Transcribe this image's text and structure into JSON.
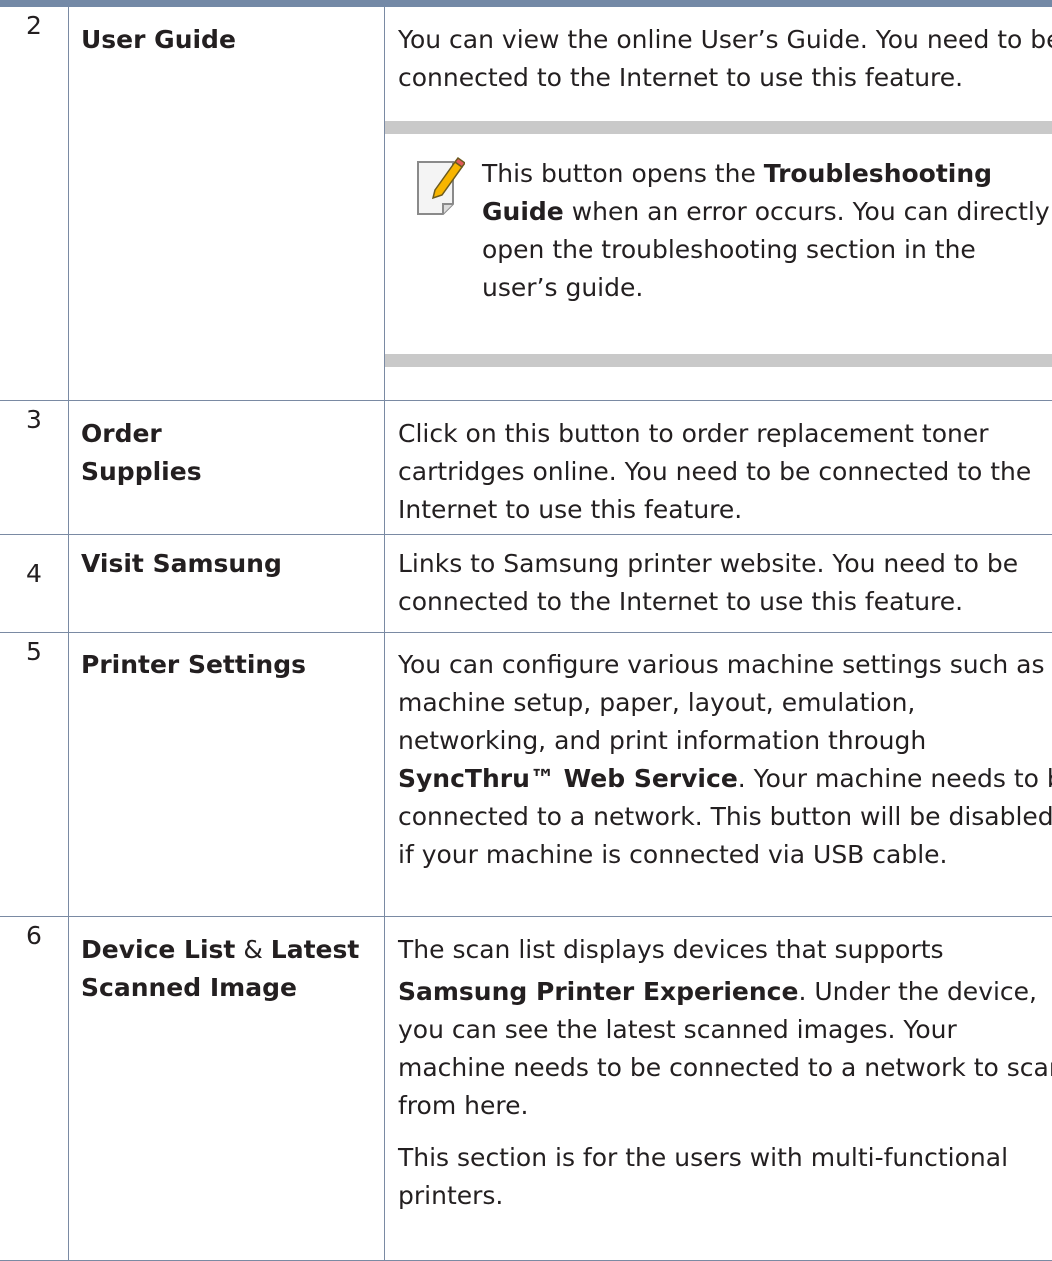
{
  "rows": [
    {
      "num": "2",
      "name": "User Guide",
      "desc_lines": [
        "You can view the online User’s Guide. You need to be",
        "connected to the Internet to use this feature."
      ],
      "note": {
        "icon": "note-pencil-icon",
        "line1_a": "This button opens the ",
        "line1_b": "Troubleshooting",
        "line2_a": "Guide",
        "line2_b": " when an error occurs. You can directly",
        "line3": "open the troubleshooting section in the",
        "line4": "user’s guide."
      }
    },
    {
      "num": "3",
      "name_line1": "Order",
      "name_line2": "Supplies",
      "desc_lines": [
        "Click on this button to order replacement toner",
        "cartridges online. You need to be connected to the",
        "Internet to use this feature."
      ]
    },
    {
      "num": "4",
      "name": "Visit Samsung",
      "desc_lines": [
        "Links to Samsung printer website. You need to be",
        "connected to the Internet to use this feature."
      ]
    },
    {
      "num": "5",
      "name": "Printer Settings",
      "desc_lines": [
        "You can configure various machine settings such as",
        "machine setup, paper, layout, emulation,",
        "networking, and print information through"
      ],
      "desc_bold": "SyncThru™ Web Service",
      "desc_after_bold": ". Your machine needs to be",
      "desc_lines_end": [
        "connected to a network. This button will be disabled",
        "if your machine is connected via USB cable."
      ]
    },
    {
      "num": "6",
      "name_a": "Device List",
      "name_amp": " & ",
      "name_b": "Latest",
      "name_c": "Scanned Image",
      "desc_line1": "The scan list displays devices that supports",
      "desc_bold": "Samsung Printer Experience",
      "desc_after_bold": ". Under the device,",
      "desc_lines": [
        "you can see the latest scanned images. Your",
        "machine needs to be connected to a network to scan",
        "from here."
      ],
      "desc_para2": [
        "This section is for the users with multi-functional",
        "printers."
      ]
    }
  ],
  "colors": {
    "header_bar": "#7489a6",
    "rule": "#7a8aa3",
    "note_band": "#c9c9c9"
  }
}
